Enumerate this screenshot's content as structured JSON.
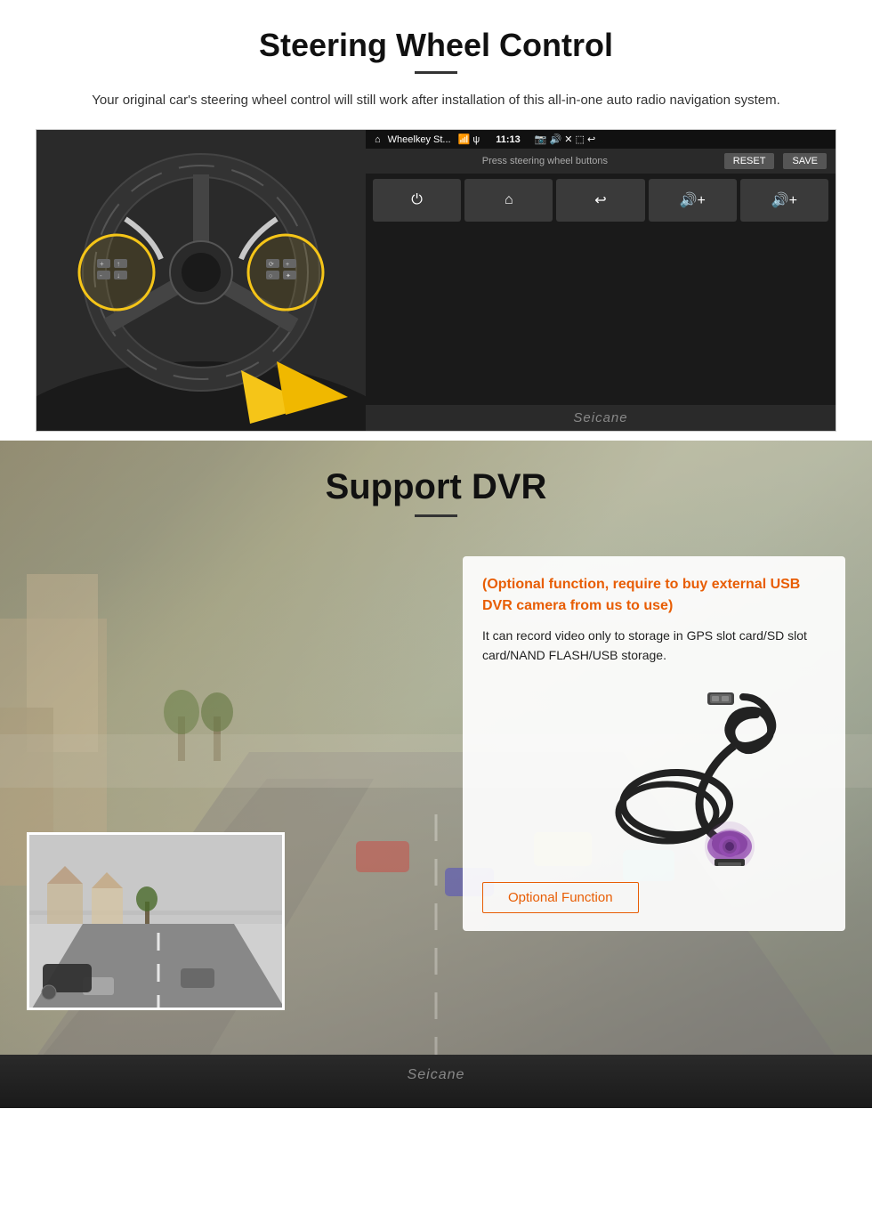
{
  "steering": {
    "title": "Steering Wheel Control",
    "description": "Your original car's steering wheel control will still work after installation of this all-in-one auto radio navigation system.",
    "screen": {
      "app_name": "Wheelkey St...",
      "time": "11:13",
      "prompt": "Press steering wheel buttons",
      "reset_btn": "RESET",
      "save_btn": "SAVE",
      "buttons": [
        {
          "icon": "⏻",
          "label": "power"
        },
        {
          "icon": "⌂",
          "label": "home"
        },
        {
          "icon": "↩",
          "label": "back"
        },
        {
          "icon": "🔊+",
          "label": "vol-up"
        },
        {
          "icon": "🔊+",
          "label": "vol-up2"
        }
      ]
    },
    "watermark": "Seicane"
  },
  "dvr": {
    "title": "Support DVR",
    "optional_text": "(Optional function, require to buy external USB DVR camera from us to use)",
    "description": "It can record video only to storage in GPS slot card/SD slot card/NAND FLASH/USB storage.",
    "optional_btn_label": "Optional Function",
    "watermark": "Seicane"
  }
}
